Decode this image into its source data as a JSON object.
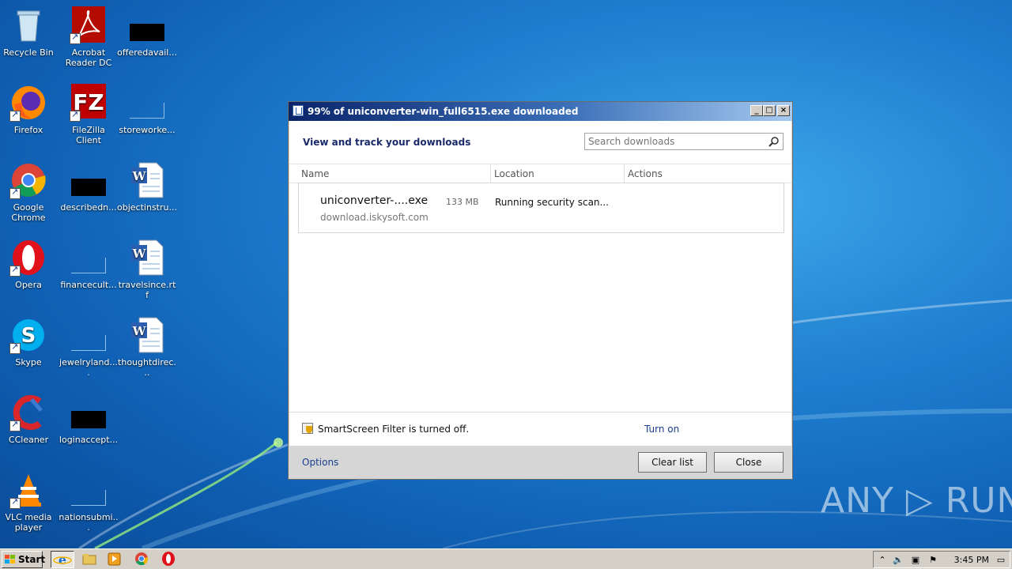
{
  "desktop": {
    "icons": [
      {
        "label": "Recycle Bin"
      },
      {
        "label": "Acrobat Reader DC"
      },
      {
        "label": "offeredavail..."
      },
      {
        "label": "Firefox"
      },
      {
        "label": "FileZilla Client"
      },
      {
        "label": "storeworke..."
      },
      {
        "label": "Google Chrome"
      },
      {
        "label": "describedn..."
      },
      {
        "label": "objectinstru..."
      },
      {
        "label": "Opera"
      },
      {
        "label": "financecult..."
      },
      {
        "label": "travelsince.rtf"
      },
      {
        "label": "Skype"
      },
      {
        "label": "jewelryland...."
      },
      {
        "label": "thoughtdirec..."
      },
      {
        "label": "CCleaner"
      },
      {
        "label": "loginaccept..."
      },
      {
        "label": "VLC media player"
      },
      {
        "label": "nationsubmi..."
      }
    ]
  },
  "dialog": {
    "title": "99% of uniconverter-win_full6515.exe downloaded",
    "heading": "View and track your downloads",
    "search_placeholder": "Search downloads",
    "columns": {
      "name": "Name",
      "location": "Location",
      "actions": "Actions"
    },
    "download": {
      "name": "uniconverter-....exe",
      "size": "133 MB",
      "source": "download.iskysoft.com",
      "status": "Running security scan..."
    },
    "smartscreen_text": "SmartScreen Filter is turned off.",
    "turn_on_label": "Turn on",
    "options_label": "Options",
    "clear_list_label": "Clear list",
    "close_label": "Close",
    "window_buttons": {
      "minimize": "_",
      "maximize": "□",
      "close": "×"
    }
  },
  "taskbar": {
    "start_label": "Start",
    "clock": "3:45 PM"
  },
  "watermark": "ANY ▷ RUN"
}
